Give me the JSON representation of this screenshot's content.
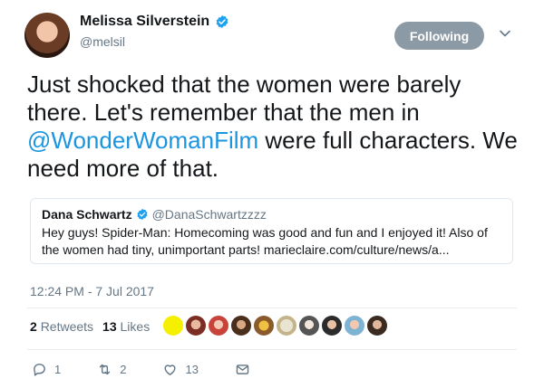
{
  "author": {
    "name": "Melissa Silverstein",
    "handle": "@melsil"
  },
  "follow_button": {
    "label": "Following"
  },
  "tweet": {
    "text_before": "Just shocked that the women were  barely there. Let's remember that the men in ",
    "mention": "@WonderWomanFilm",
    "text_after": " were full characters. We need more of that."
  },
  "quoted_tweet": {
    "name": "Dana Schwartz",
    "handle": "@DanaSchwartzzzz",
    "text": "Hey guys! Spider-Man: Homecoming was good and fun and I enjoyed it! Also of the women had tiny, unimportant parts! marieclaire.com/culture/news/a..."
  },
  "timestamp": "12:24 PM - 7 Jul 2017",
  "stats": {
    "retweets_count": "2",
    "retweets_label": "Retweets",
    "likes_count": "13",
    "likes_label": "Likes"
  },
  "actions": {
    "reply_count": "1",
    "retweet_count": "2",
    "like_count": "13"
  },
  "colors": {
    "accent": "#1b95e0",
    "following_button": "#8c9aa6",
    "verified": "#1da1f2"
  },
  "icons": {
    "verified": "verified-badge-icon",
    "caret": "chevron-down-icon",
    "reply": "reply-icon",
    "retweet": "retweet-icon",
    "like": "heart-icon",
    "dm": "envelope-icon"
  }
}
